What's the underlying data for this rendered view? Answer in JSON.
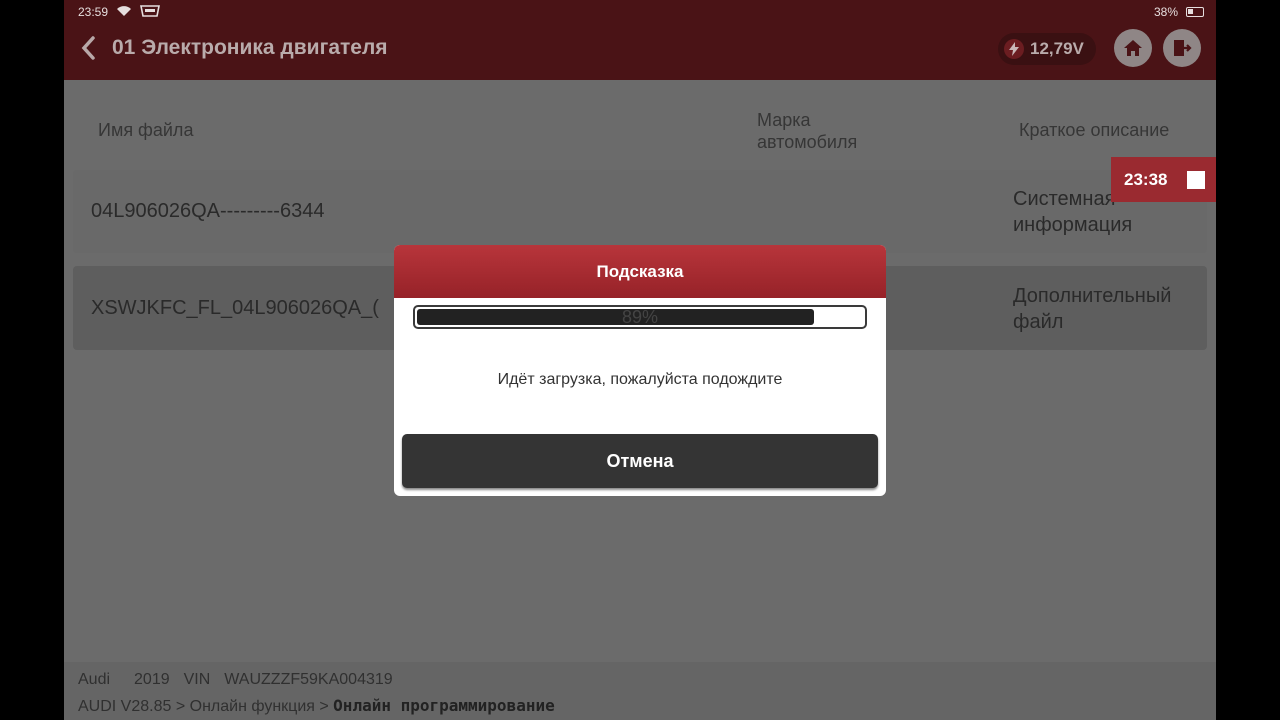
{
  "status_bar": {
    "time": "23:59",
    "battery_percent": "38%"
  },
  "header": {
    "title": "01 Электроника двигателя",
    "voltage": "12,79V"
  },
  "table": {
    "columns": [
      "Имя файла",
      "Марка\nавтомобиля",
      "Краткое описание"
    ],
    "rows": [
      {
        "file": "04L906026QA---------6344",
        "brand": "",
        "desc": "Системная\nинформация"
      },
      {
        "file": "XSWJKFC_FL_04L906026QA_(",
        "brand": "",
        "desc": "Дополнительный\nфайл"
      }
    ]
  },
  "timer": {
    "time": "23:38"
  },
  "dialog": {
    "title": "Подсказка",
    "progress_text": "89%",
    "progress": 0.89,
    "message": "Идёт загрузка, пожалуйста подождите",
    "cancel_label": "Отмена"
  },
  "footer": {
    "make": "Audi",
    "year": "2019",
    "vin_label": "VIN",
    "vin": "WAUZZZF59KA004319",
    "breadcrumb_path": "AUDI V28.85 > Онлайн функция > ",
    "breadcrumb_current": "Онлайн программирование"
  },
  "colors": {
    "header_bg": "#4a1316",
    "accent": "#b8353b",
    "overlay_bg": "#6b6b6b"
  }
}
